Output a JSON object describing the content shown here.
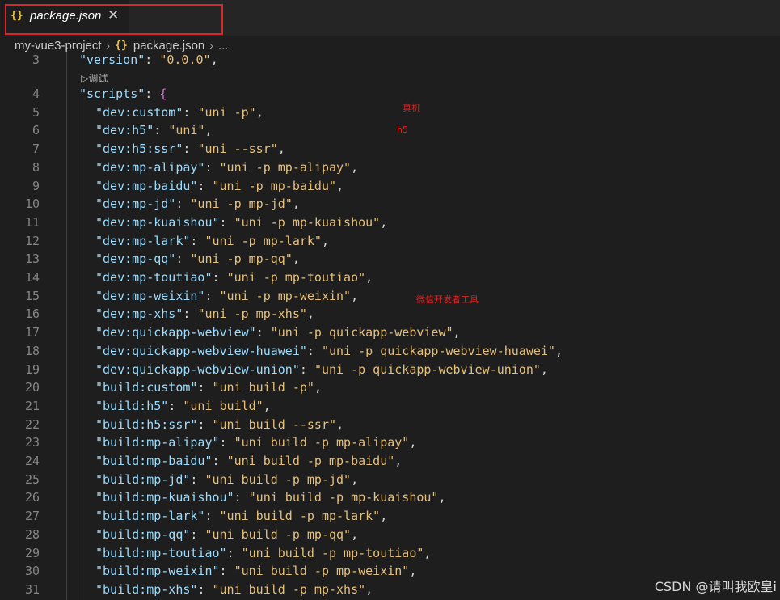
{
  "tab": {
    "icon": "{}",
    "label": "package.json",
    "close": "✕"
  },
  "breadcrumb": {
    "project": "my-vue3-project",
    "sep": "›",
    "icon": "{}",
    "file": "package.json",
    "more": "..."
  },
  "codelens": "▷调试",
  "lines": [
    {
      "n": "3",
      "indent": 1,
      "key": "\"version\"",
      "val": "\"0.0.0\"",
      "tail": ","
    },
    {
      "n": "4",
      "indent": 1,
      "key": "\"scripts\"",
      "val": "",
      "tail": "{"
    },
    {
      "n": "5",
      "indent": 2,
      "key": "\"dev:custom\"",
      "val": "\"uni -p\"",
      "tail": ","
    },
    {
      "n": "6",
      "indent": 2,
      "key": "\"dev:h5\"",
      "val": "\"uni\"",
      "tail": ","
    },
    {
      "n": "7",
      "indent": 2,
      "key": "\"dev:h5:ssr\"",
      "val": "\"uni --ssr\"",
      "tail": ","
    },
    {
      "n": "8",
      "indent": 2,
      "key": "\"dev:mp-alipay\"",
      "val": "\"uni -p mp-alipay\"",
      "tail": ","
    },
    {
      "n": "9",
      "indent": 2,
      "key": "\"dev:mp-baidu\"",
      "val": "\"uni -p mp-baidu\"",
      "tail": ","
    },
    {
      "n": "10",
      "indent": 2,
      "key": "\"dev:mp-jd\"",
      "val": "\"uni -p mp-jd\"",
      "tail": ","
    },
    {
      "n": "11",
      "indent": 2,
      "key": "\"dev:mp-kuaishou\"",
      "val": "\"uni -p mp-kuaishou\"",
      "tail": ","
    },
    {
      "n": "12",
      "indent": 2,
      "key": "\"dev:mp-lark\"",
      "val": "\"uni -p mp-lark\"",
      "tail": ","
    },
    {
      "n": "13",
      "indent": 2,
      "key": "\"dev:mp-qq\"",
      "val": "\"uni -p mp-qq\"",
      "tail": ","
    },
    {
      "n": "14",
      "indent": 2,
      "key": "\"dev:mp-toutiao\"",
      "val": "\"uni -p mp-toutiao\"",
      "tail": ","
    },
    {
      "n": "15",
      "indent": 2,
      "key": "\"dev:mp-weixin\"",
      "val": "\"uni -p mp-weixin\"",
      "tail": ","
    },
    {
      "n": "16",
      "indent": 2,
      "key": "\"dev:mp-xhs\"",
      "val": "\"uni -p mp-xhs\"",
      "tail": ","
    },
    {
      "n": "17",
      "indent": 2,
      "key": "\"dev:quickapp-webview\"",
      "val": "\"uni -p quickapp-webview\"",
      "tail": ","
    },
    {
      "n": "18",
      "indent": 2,
      "key": "\"dev:quickapp-webview-huawei\"",
      "val": "\"uni -p quickapp-webview-huawei\"",
      "tail": ","
    },
    {
      "n": "19",
      "indent": 2,
      "key": "\"dev:quickapp-webview-union\"",
      "val": "\"uni -p quickapp-webview-union\"",
      "tail": ","
    },
    {
      "n": "20",
      "indent": 2,
      "key": "\"build:custom\"",
      "val": "\"uni build -p\"",
      "tail": ","
    },
    {
      "n": "21",
      "indent": 2,
      "key": "\"build:h5\"",
      "val": "\"uni build\"",
      "tail": ","
    },
    {
      "n": "22",
      "indent": 2,
      "key": "\"build:h5:ssr\"",
      "val": "\"uni build --ssr\"",
      "tail": ","
    },
    {
      "n": "23",
      "indent": 2,
      "key": "\"build:mp-alipay\"",
      "val": "\"uni build -p mp-alipay\"",
      "tail": ","
    },
    {
      "n": "24",
      "indent": 2,
      "key": "\"build:mp-baidu\"",
      "val": "\"uni build -p mp-baidu\"",
      "tail": ","
    },
    {
      "n": "25",
      "indent": 2,
      "key": "\"build:mp-jd\"",
      "val": "\"uni build -p mp-jd\"",
      "tail": ","
    },
    {
      "n": "26",
      "indent": 2,
      "key": "\"build:mp-kuaishou\"",
      "val": "\"uni build -p mp-kuaishou\"",
      "tail": ","
    },
    {
      "n": "27",
      "indent": 2,
      "key": "\"build:mp-lark\"",
      "val": "\"uni build -p mp-lark\"",
      "tail": ","
    },
    {
      "n": "28",
      "indent": 2,
      "key": "\"build:mp-qq\"",
      "val": "\"uni build -p mp-qq\"",
      "tail": ","
    },
    {
      "n": "29",
      "indent": 2,
      "key": "\"build:mp-toutiao\"",
      "val": "\"uni build -p mp-toutiao\"",
      "tail": ","
    },
    {
      "n": "30",
      "indent": 2,
      "key": "\"build:mp-weixin\"",
      "val": "\"uni build -p mp-weixin\"",
      "tail": ","
    },
    {
      "n": "31",
      "indent": 2,
      "key": "\"build:mp-xhs\"",
      "val": "\"uni build -p mp-xhs\"",
      "tail": ","
    }
  ],
  "notes": {
    "device": "真机",
    "h5": "h5",
    "weixin_tool": "微信开发者工具"
  },
  "watermark": "CSDN @请叫我欧皇i",
  "colors": {
    "key": "#9cdcfe",
    "value": "#e6c07b",
    "annotation": "#e02020",
    "highlight_box": "#e0242b"
  }
}
